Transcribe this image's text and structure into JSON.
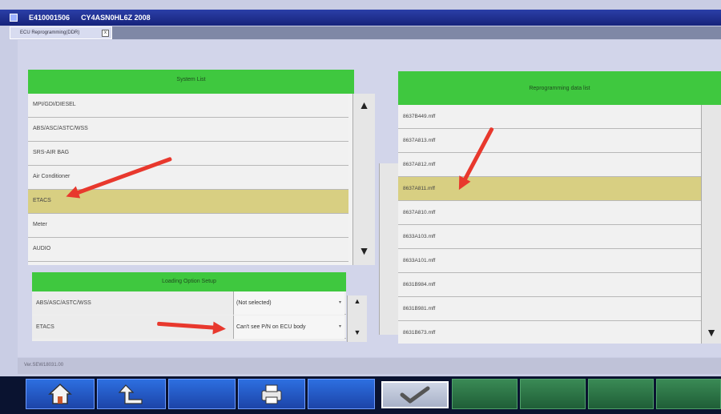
{
  "window": {
    "title_left": "E410001506",
    "title_right": "CY4ASN0HL6Z 2008"
  },
  "tab": {
    "label": "ECU Reprogramming(DDR)",
    "close_label": "x"
  },
  "system_list": {
    "header": "System List",
    "items": [
      {
        "label": "MPI/GDI/DIESEL",
        "selected": false
      },
      {
        "label": "ABS/ASC/ASTC/WSS",
        "selected": false
      },
      {
        "label": "SRS-AIR BAG",
        "selected": false
      },
      {
        "label": "Air Conditioner",
        "selected": false
      },
      {
        "label": "ETACS",
        "selected": true
      },
      {
        "label": "Meter",
        "selected": false
      },
      {
        "label": "AUDIO",
        "selected": false
      }
    ]
  },
  "loading_option": {
    "header": "Loading Option Setup",
    "rows": [
      {
        "label": "ABS/ASC/ASTC/WSS",
        "value": "(Not selected)"
      },
      {
        "label": "ETACS",
        "value": "Can't see P/N on ECU body"
      }
    ]
  },
  "reprogramming_list": {
    "header": "Reprogramming data list",
    "items": [
      {
        "label": "8637B449.mff",
        "selected": false
      },
      {
        "label": "8637A813.mff",
        "selected": false
      },
      {
        "label": "8637A812.mff",
        "selected": false
      },
      {
        "label": "8637A811.mff",
        "selected": true
      },
      {
        "label": "8637A810.mff",
        "selected": false
      },
      {
        "label": "8633A103.mff",
        "selected": false
      },
      {
        "label": "8633A101.mff",
        "selected": false
      },
      {
        "label": "8631B984.mff",
        "selected": false
      },
      {
        "label": "8631B981.mff",
        "selected": false
      },
      {
        "label": "8631B673.mff",
        "selected": false
      }
    ]
  },
  "status": {
    "version": "Ver.SEW18031.00"
  },
  "toolbar": {
    "icons": [
      "home-icon",
      "back-icon",
      "printer-icon",
      "checkmark-icon"
    ]
  },
  "colors": {
    "header_green": "#3fc83f",
    "selected_row": "#d8cf82",
    "annotation_arrow": "#e8382d"
  }
}
